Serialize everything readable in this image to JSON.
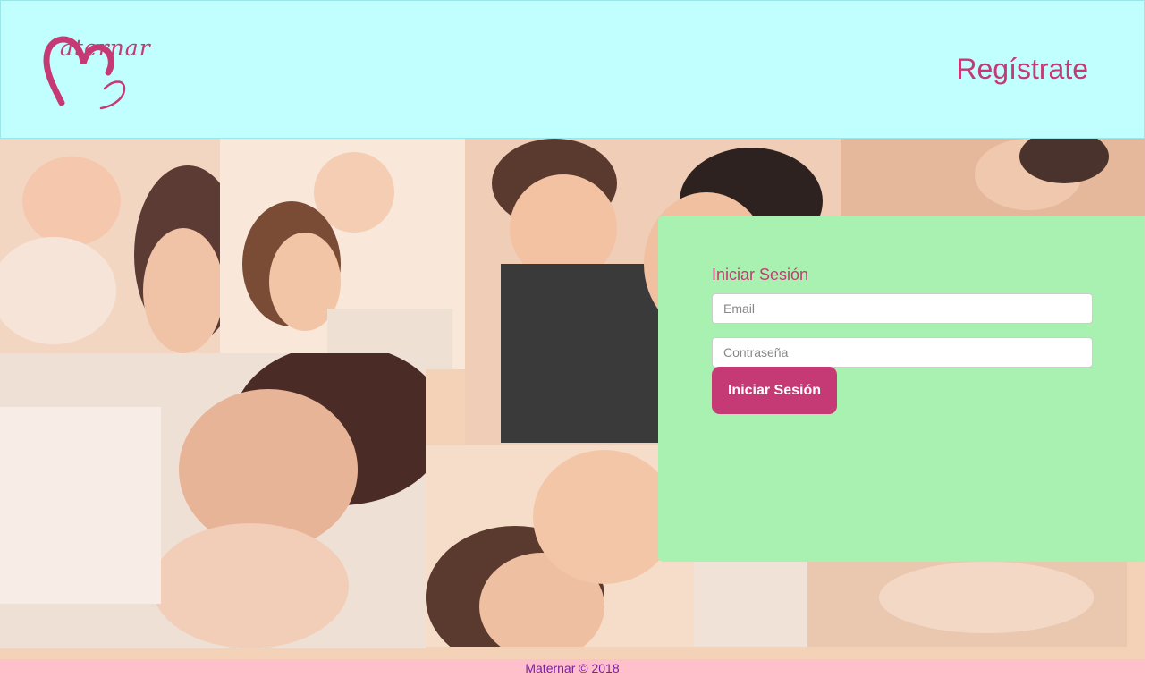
{
  "header": {
    "logo_text": "aternar",
    "register_label": "Regístrate"
  },
  "login": {
    "title": "Iniciar Sesión",
    "email_placeholder": "Email",
    "password_placeholder": "Contraseña",
    "submit_label": "Iniciar Sesión"
  },
  "footer": {
    "text": "Maternar © 2018"
  },
  "colors": {
    "header_bg": "#c1ffff",
    "panel_bg": "#a9f1b0",
    "accent": "#c53a74",
    "page_bg": "#ffc0cb",
    "footer_text": "#7a1fa2"
  }
}
